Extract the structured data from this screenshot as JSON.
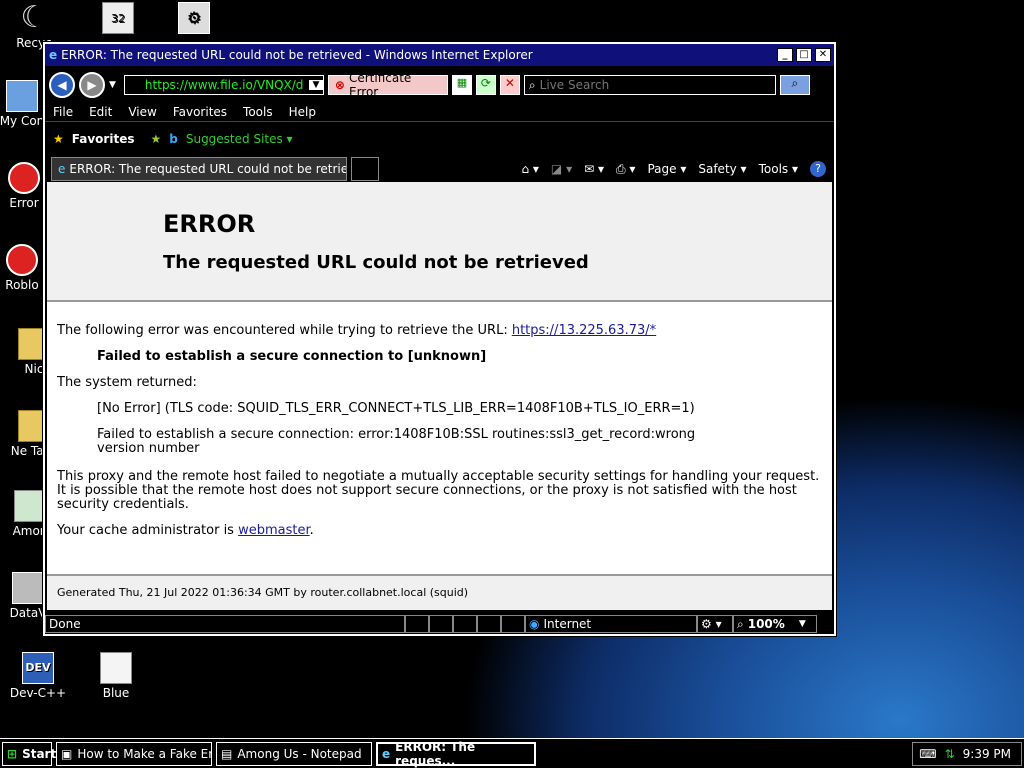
{
  "desktop": {
    "icons": [
      "Recyc",
      "My Con",
      "Error",
      "Roblo",
      "Nic",
      "Ne Tab_",
      "Amon",
      "DataV",
      "Dev-C++",
      "Blue"
    ]
  },
  "window": {
    "title": "ERROR: The requested URL could not be retrieved - Windows Internet Explorer",
    "minimize": "_",
    "maximize": "□",
    "close": "✕"
  },
  "address": {
    "url": "https://www.file.io/VNQX/d",
    "cert_error": "Certificate Error",
    "search_placeholder": "Live Search"
  },
  "menu": [
    "File",
    "Edit",
    "View",
    "Favorites",
    "Tools",
    "Help"
  ],
  "favorites": {
    "favorites_label": "Favorites",
    "suggested_sites": "Suggested Sites ▾"
  },
  "tab": {
    "title": "ERROR: The requested URL could not be retrieved"
  },
  "commands": {
    "page": "Page ▾",
    "safety": "Safety ▾",
    "tools": "Tools ▾"
  },
  "page": {
    "h1": "ERROR",
    "h2": "The requested URL could not be retrieved",
    "p1_text": "The following error was encountered while trying to retrieve the URL: ",
    "p1_link": "https://13.225.63.73/*",
    "p2": "Failed to establish a secure connection to [unknown]",
    "p3": "The system returned:",
    "p4": "[No Error] (TLS code: SQUID_TLS_ERR_CONNECT+TLS_LIB_ERR=1408F10B+TLS_IO_ERR=1)",
    "p5": "Failed to establish a secure connection: error:1408F10B:SSL routines:ssl3_get_record:wrong version number",
    "p6": "This proxy and the remote host failed to negotiate a mutually acceptable security settings for handling your request. It is possible that the remote host does not support secure connections, or the proxy is not satisfied with the host security credentials.",
    "p7_text": "Your cache administrator is ",
    "p7_link": "webmaster",
    "p7_end": ".",
    "footer": "Generated Thu, 21 Jul 2022 01:36:34 GMT by router.collabnet.local (squid)"
  },
  "status": {
    "text": "Done",
    "zone": "Internet",
    "zoom": "100%"
  },
  "taskbar": {
    "start": "Start",
    "items": [
      "How to Make a Fake Err...",
      "Among Us - Notepad",
      "ERROR: The reques..."
    ],
    "clock": "9:39 PM"
  }
}
